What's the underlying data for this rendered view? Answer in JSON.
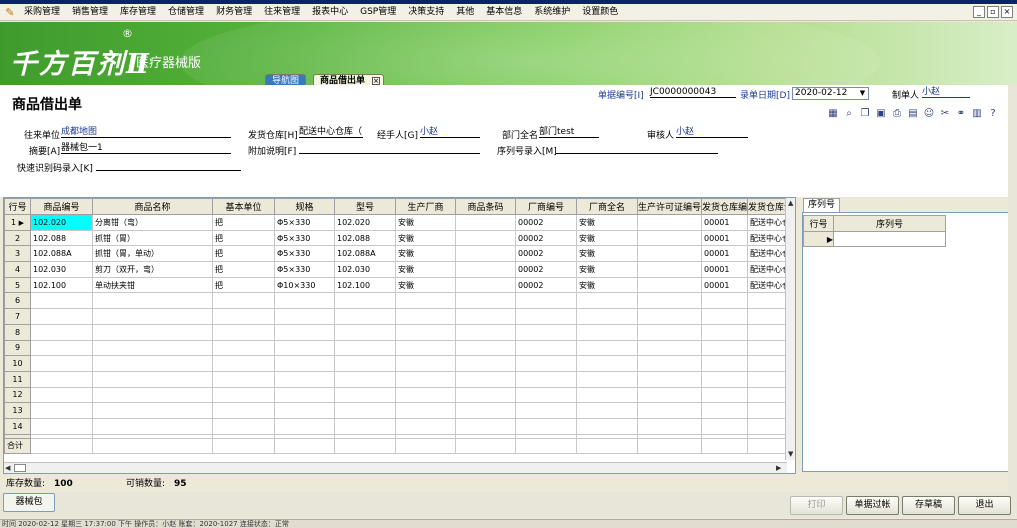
{
  "menu": {
    "items": [
      "采购管理",
      "销售管理",
      "库存管理",
      "仓储管理",
      "财务管理",
      "往来管理",
      "报表中心",
      "GSP管理",
      "决策支持",
      "其他",
      "基本信息",
      "系统维护",
      "设置颜色"
    ],
    "window_buttons": [
      "_",
      "▫",
      "×"
    ]
  },
  "banner": {
    "logo_text": "千方百剂Ⅱ",
    "reg_mark": "®",
    "subtitle": "医疗器械版",
    "tabs": [
      "导航图",
      "商品借出单"
    ],
    "close_glyph": "×"
  },
  "form": {
    "title": "商品借出单",
    "doc_no_label": "单据编号[I]",
    "doc_no": "JC0000000043",
    "date_label": "录单日期[D]",
    "date": "2020-02-12",
    "maker_label": "制单人",
    "maker": "小赵",
    "partner_label": "往来单位",
    "partner": "成都地图",
    "warehouse_label": "发货仓库[H]",
    "warehouse": "配送中心仓库（",
    "handler_label": "经手人[G]",
    "handler": "小赵",
    "dept_label": "部门全名",
    "dept": "部门test",
    "auditor_label": "审核人",
    "auditor": "小赵",
    "summary_label": "摘要[A]",
    "summary": "器械包一1",
    "note_label": "附加说明[F]",
    "note": "",
    "serial_entry_label": "序列号录入[M]",
    "serial_entry": "",
    "quick_code_label": "快速识别码录入[K]",
    "quick_code": ""
  },
  "grid": {
    "columns": [
      "行号",
      "商品编号",
      "商品名称",
      "基本单位",
      "规格",
      "型号",
      "生产厂商",
      "商品条码",
      "厂商编号",
      "厂商全名",
      "生产许可证编号",
      "发货仓库编",
      "发货仓库全"
    ],
    "rows": [
      [
        "1",
        "102.020",
        "分离钳（弯）",
        "把",
        "Φ5×330",
        "102.020",
        "安徽",
        "",
        "00002",
        "安徽",
        "",
        "00001",
        "配送中心仓"
      ],
      [
        "2",
        "102.088",
        "抓钳（胃）",
        "把",
        "Φ5×330",
        "102.088",
        "安徽",
        "",
        "00002",
        "安徽",
        "",
        "00001",
        "配送中心仓"
      ],
      [
        "3",
        "102.088A",
        "抓钳（胃，单动）",
        "把",
        "Φ5×330",
        "102.088A",
        "安徽",
        "",
        "00002",
        "安徽",
        "",
        "00001",
        "配送中心仓"
      ],
      [
        "4",
        "102.030",
        "剪刀（双开，弯）",
        "把",
        "Φ5×330",
        "102.030",
        "安徽",
        "",
        "00002",
        "安徽",
        "",
        "00001",
        "配送中心仓"
      ],
      [
        "5",
        "102.100",
        "单动扶夹钳",
        "把",
        "Φ10×330",
        "102.100",
        "安徽",
        "",
        "00002",
        "安徽",
        "",
        "00001",
        "配送中心仓"
      ]
    ],
    "empty_row_numbers": [
      "6",
      "7",
      "8",
      "9",
      "10",
      "11",
      "12",
      "13",
      "14"
    ],
    "total_label": "合计",
    "current_row_marker": "▶"
  },
  "serial_panel": {
    "tab_label": "序列号",
    "columns": [
      "行号",
      "序列号"
    ],
    "row_marker": "▶"
  },
  "status": {
    "stock_label": "库存数量:",
    "stock_value": "100",
    "sellable_label": "可销数量:",
    "sellable_value": "95"
  },
  "bottom": {
    "category_button": "器械包",
    "print": "打印",
    "filter": "单据过帐",
    "draft": "存草稿",
    "exit": "退出"
  },
  "statusbar_text": "时间 2020-02-12  星期三  17:37:00  下午    操作员：小赵    账套：2020-1027    连接状态：正常"
}
